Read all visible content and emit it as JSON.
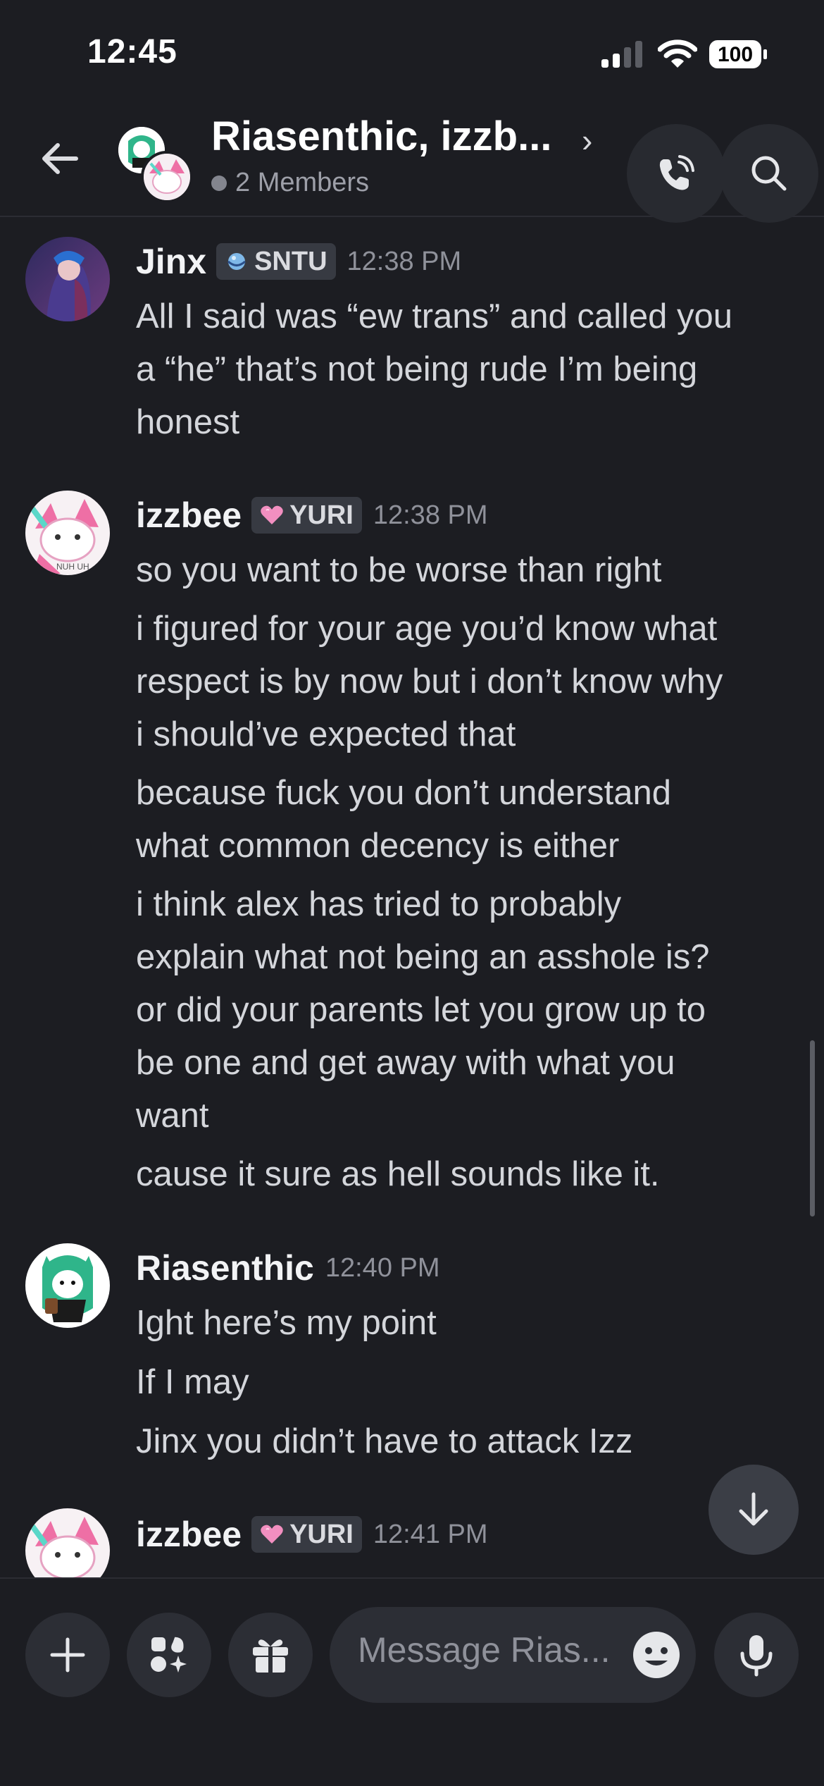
{
  "status_bar": {
    "time": "12:45",
    "battery": "100"
  },
  "header": {
    "title": "Riasenthic, izzb...",
    "chevron": "›",
    "members": "2 Members"
  },
  "messages": [
    {
      "author": "Jinx",
      "tag": "SNTU",
      "tag_icon": "planet-icon",
      "time": "12:38 PM",
      "avatar_colors": [
        "#4b2f6b",
        "#8a5aa8"
      ],
      "lines": [
        "All I said was “ew trans” and called you",
        "a “he” that’s not being rude I’m being",
        "honest"
      ]
    },
    {
      "author": "izzbee",
      "tag": "YURI",
      "tag_icon": "pink-heart-icon",
      "time": "12:38 PM",
      "avatar_text": "NUH UH",
      "lines": [
        "so you want to be worse than right",
        "i figured for your age you’d know what",
        "respect is by now but i don’t know why",
        "i should’ve expected that",
        "because fuck you don’t understand",
        "what common decency is either",
        "i think alex has tried to probably",
        "explain what not being an asshole is?",
        "or did your parents let you grow up to",
        "be one and get away with what you",
        "want",
        "cause it sure as hell sounds like it."
      ]
    },
    {
      "author": "Riasenthic",
      "tag": "",
      "time": "12:40 PM",
      "lines": [
        "Ight here’s my point",
        "If I may",
        "Jinx you didn’t have to attack Izz"
      ]
    },
    {
      "author": "izzbee",
      "tag": "YURI",
      "tag_icon": "pink-heart-icon",
      "time": "12:41 PM",
      "lines": []
    }
  ],
  "composer": {
    "placeholder": "Message Rias..."
  },
  "colors": {
    "background": "#1c1d22",
    "accent": "#5865f2",
    "tag_bg": "#373a42",
    "button_bg": "#2c2e35"
  }
}
